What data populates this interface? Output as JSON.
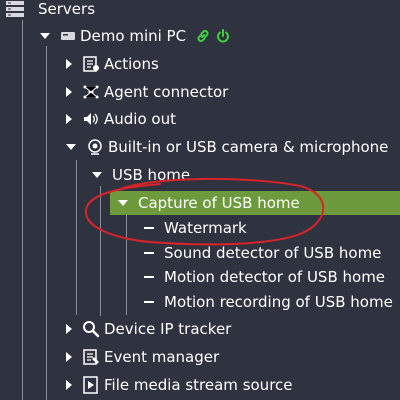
{
  "tree": {
    "root": {
      "label": "Servers",
      "icon": "server-rack-icon"
    },
    "server": {
      "label": "Demo mini PC",
      "icon": "mini-pc-icon",
      "status_icons": [
        "link-icon",
        "power-icon"
      ]
    },
    "items": [
      {
        "label": "Actions",
        "icon": "actions-icon",
        "state": "collapsed"
      },
      {
        "label": "Agent connector",
        "icon": "agent-connector-icon",
        "state": "collapsed"
      },
      {
        "label": "Audio out",
        "icon": "speaker-icon",
        "state": "collapsed"
      },
      {
        "label": "Built-in or USB camera & microphone",
        "icon": "webcam-icon",
        "state": "expanded"
      },
      {
        "label": "Device IP tracker",
        "icon": "magnifier-icon",
        "state": "collapsed"
      },
      {
        "label": "Event manager",
        "icon": "event-manager-icon",
        "state": "collapsed"
      },
      {
        "label": "File media stream source",
        "icon": "media-file-icon",
        "state": "collapsed"
      }
    ],
    "usb_home": {
      "label": "USB home",
      "state": "expanded"
    },
    "capture": {
      "label": "Capture of USB home",
      "state": "expanded",
      "selected": true
    },
    "capture_children": [
      {
        "label": "Watermark"
      },
      {
        "label": "Sound detector of USB home"
      },
      {
        "label": "Motion detector of USB home"
      },
      {
        "label": "Motion recording of USB home"
      }
    ]
  },
  "colors": {
    "background": "#2f3340",
    "selection": "#6c9a3c",
    "annotation": "#d9232a",
    "status_green": "#3fcf3f"
  }
}
